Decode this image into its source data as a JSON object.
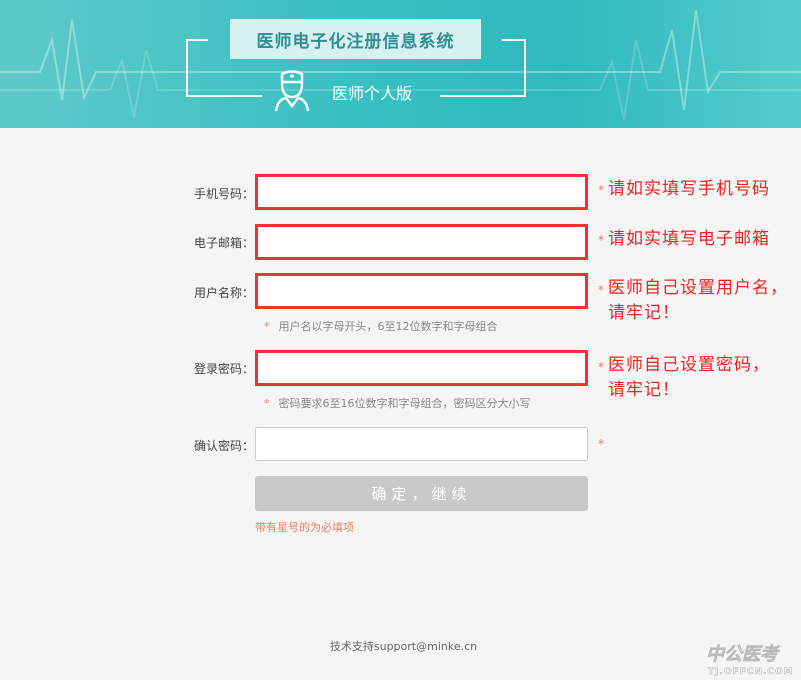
{
  "header": {
    "system_title": "医师电子化注册信息系统",
    "edition": "医师个人版"
  },
  "form": {
    "phone_label": "手机号码：",
    "email_label": "电子邮箱：",
    "username_label": "用户名称：",
    "username_hint": "用户名以字母开头，6至12位数字和字母组合",
    "password_label": "登录密码：",
    "password_hint": "密码要求6至16位数字和字母组合，密码区分大小写",
    "confirm_label": "确认密码：",
    "required_mark": "*",
    "submit_label": "确定，继续",
    "required_note": "带有星号的为必填项"
  },
  "annotations": {
    "phone_note": "请如实填写手机号码",
    "email_note": "请如实填写电子邮箱",
    "username_note_1": "医师自己设置用户名，",
    "username_note_2": "请牢记！",
    "password_note_1": "医师自己设置密码，",
    "password_note_2": "请牢记！"
  },
  "footer": {
    "support": "技术支持support@minke.cn"
  },
  "watermark": {
    "brand": "中公医考",
    "domain": "TJ.OFFCN.COM"
  },
  "colors": {
    "banner": "#38bfc2",
    "highlight_border": "#e33333",
    "annotation_text": "#e22222",
    "submit_disabled": "#c9c9c9"
  }
}
